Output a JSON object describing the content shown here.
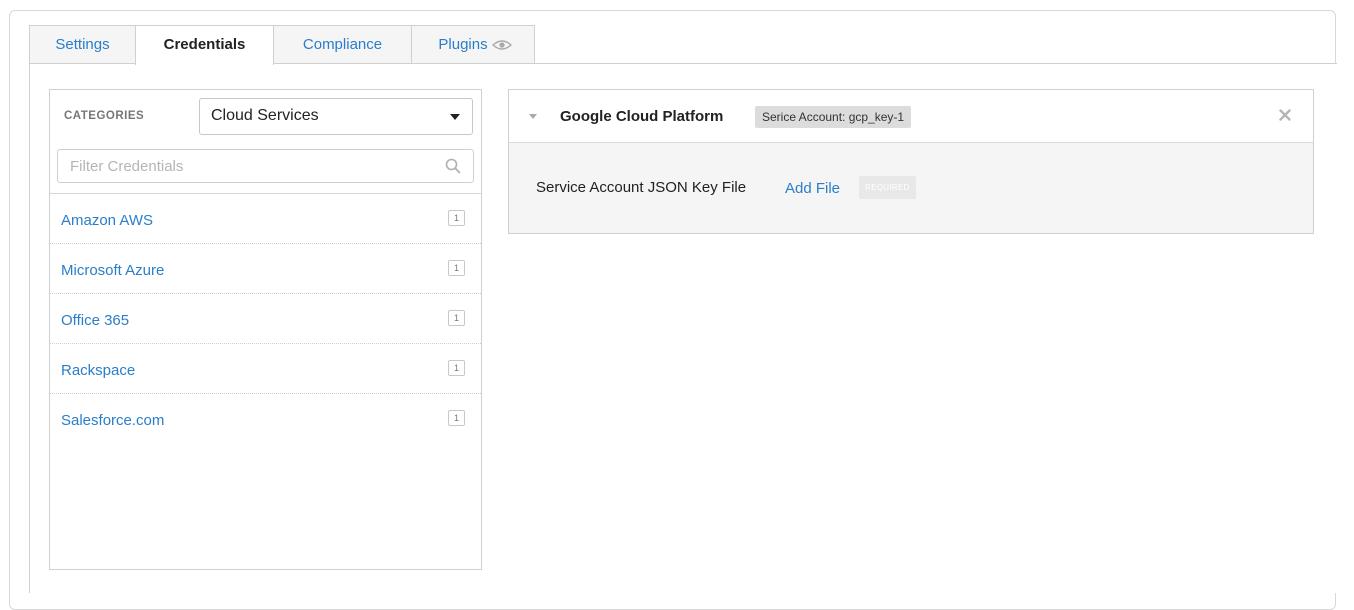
{
  "tabs": {
    "settings": "Settings",
    "credentials": "Credentials",
    "compliance": "Compliance",
    "plugins": "Plugins"
  },
  "sidebar": {
    "categories_label": "CATEGORIES",
    "selected_category": "Cloud Services",
    "filter_placeholder": "Filter Credentials",
    "items": [
      {
        "label": "Amazon AWS",
        "count": "1"
      },
      {
        "label": "Microsoft Azure",
        "count": "1"
      },
      {
        "label": "Office 365",
        "count": "1"
      },
      {
        "label": "Rackspace",
        "count": "1"
      },
      {
        "label": "Salesforce.com",
        "count": "1"
      }
    ]
  },
  "credential": {
    "title": "Google Cloud Platform",
    "badge": "Serice Account: gcp_key-1",
    "field_label": "Service Account JSON Key File",
    "add_file": "Add File",
    "required": "REQUIRED"
  },
  "colors": {
    "link": "#2a7ec9",
    "border": "#d0d0d0",
    "panel_bg": "#f5f5f5"
  }
}
